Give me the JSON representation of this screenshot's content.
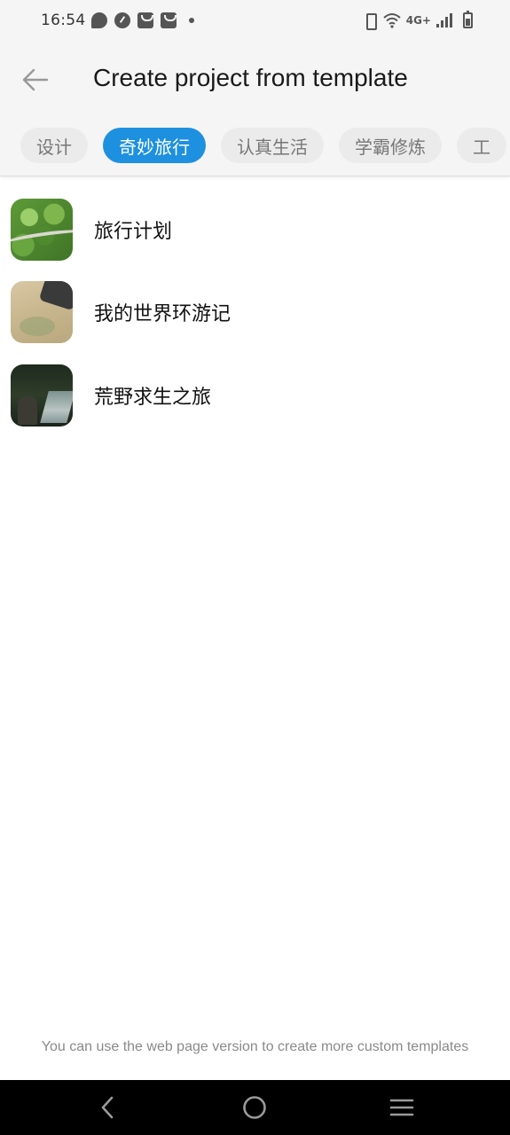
{
  "status_bar": {
    "time": "16:54",
    "network": "4G+",
    "left_icons": [
      "chat-icon",
      "gauge-icon",
      "bag-icon",
      "bag-icon",
      "dot-icon"
    ],
    "right_icons": [
      "vibrate-icon",
      "wifi-icon",
      "signal-icon",
      "battery-icon"
    ]
  },
  "app_bar": {
    "back_icon": "arrow-left-icon",
    "title": "Create project from template"
  },
  "tabs": [
    {
      "label": "设计",
      "active": false
    },
    {
      "label": "奇妙旅行",
      "active": true
    },
    {
      "label": "认真生活",
      "active": false
    },
    {
      "label": "学霸修炼",
      "active": false
    },
    {
      "label": "工",
      "active": false
    }
  ],
  "templates": [
    {
      "label": "旅行计划",
      "thumbnail": "forest-road-image"
    },
    {
      "label": "我的世界环游记",
      "thumbnail": "map-camera-image"
    },
    {
      "label": "荒野求生之旅",
      "thumbnail": "wild-waterfall-image"
    }
  ],
  "footer_note": "You can use the web page version to create more custom templates",
  "nav_bar": {
    "icons": [
      "back-nav-icon",
      "home-nav-icon",
      "menu-nav-icon"
    ]
  },
  "colors": {
    "accent": "#1e90e0",
    "header_bg": "#f5f5f5",
    "tab_inactive_bg": "#ebebeb",
    "tab_inactive_text": "#777777",
    "nav_bg": "#000000"
  }
}
